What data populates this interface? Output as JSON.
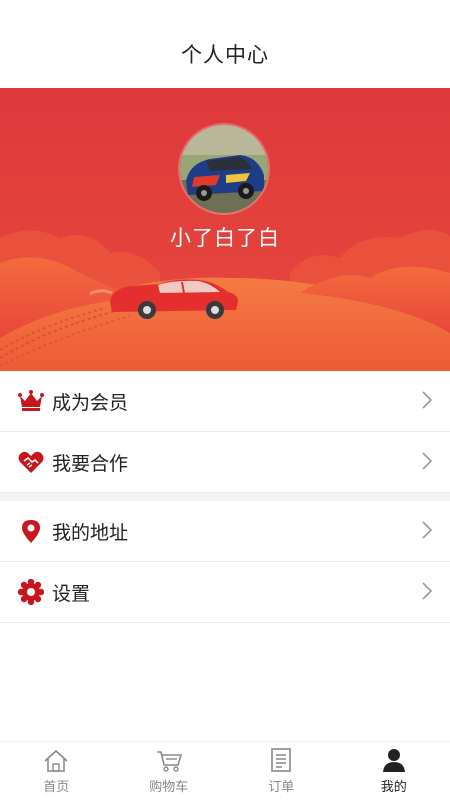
{
  "header": {
    "title": "个人中心"
  },
  "profile": {
    "username": "小了白了白"
  },
  "menu": {
    "group1": [
      {
        "label": "成为会员",
        "icon": "crown-icon"
      },
      {
        "label": "我要合作",
        "icon": "handshake-heart-icon"
      }
    ],
    "group2": [
      {
        "label": "我的地址",
        "icon": "location-pin-icon"
      },
      {
        "label": "设置",
        "icon": "gear-icon"
      }
    ]
  },
  "tabbar": {
    "tabs": [
      {
        "label": "首页",
        "icon": "home-icon",
        "active": false
      },
      {
        "label": "购物车",
        "icon": "cart-icon",
        "active": false
      },
      {
        "label": "订单",
        "icon": "order-list-icon",
        "active": false
      },
      {
        "label": "我的",
        "icon": "user-icon",
        "active": true
      }
    ]
  },
  "colors": {
    "accent": "#d9383a",
    "banner_top": "#df3b3d",
    "banner_hill": "#f06a3c",
    "active_tab": "#222222",
    "inactive_tab": "#888888"
  }
}
